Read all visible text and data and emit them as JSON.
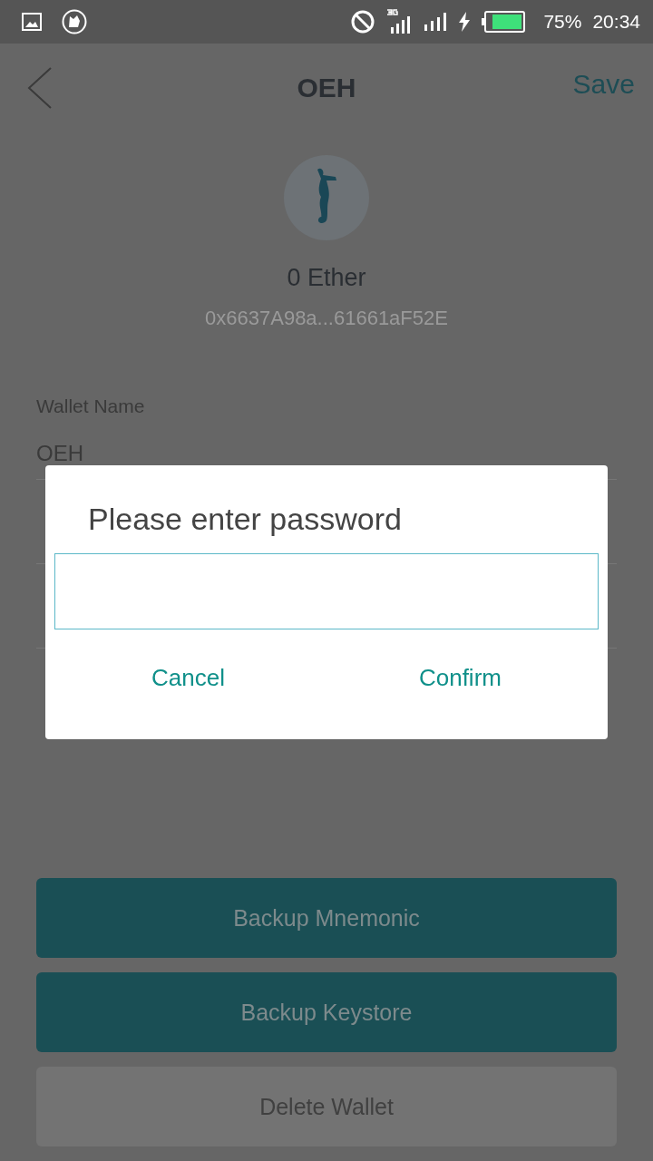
{
  "status_bar": {
    "battery": "75%",
    "time": "20:34"
  },
  "header": {
    "title": "OEH",
    "action": "Save"
  },
  "wallet": {
    "balance": "0 Ether",
    "address": "0x6637A98a...61661aF52E"
  },
  "form": [
    {
      "label": "Wallet Name",
      "value": "OEH"
    }
  ],
  "buttons": [
    {
      "label": "Backup Mnemonic",
      "kind": "primary"
    },
    {
      "label": "Backup Keystore",
      "kind": "primary"
    },
    {
      "label": "Delete Wallet",
      "kind": "secondary"
    }
  ],
  "dialog": {
    "title": "Please enter password",
    "actions": [
      "Cancel",
      "Confirm"
    ]
  }
}
